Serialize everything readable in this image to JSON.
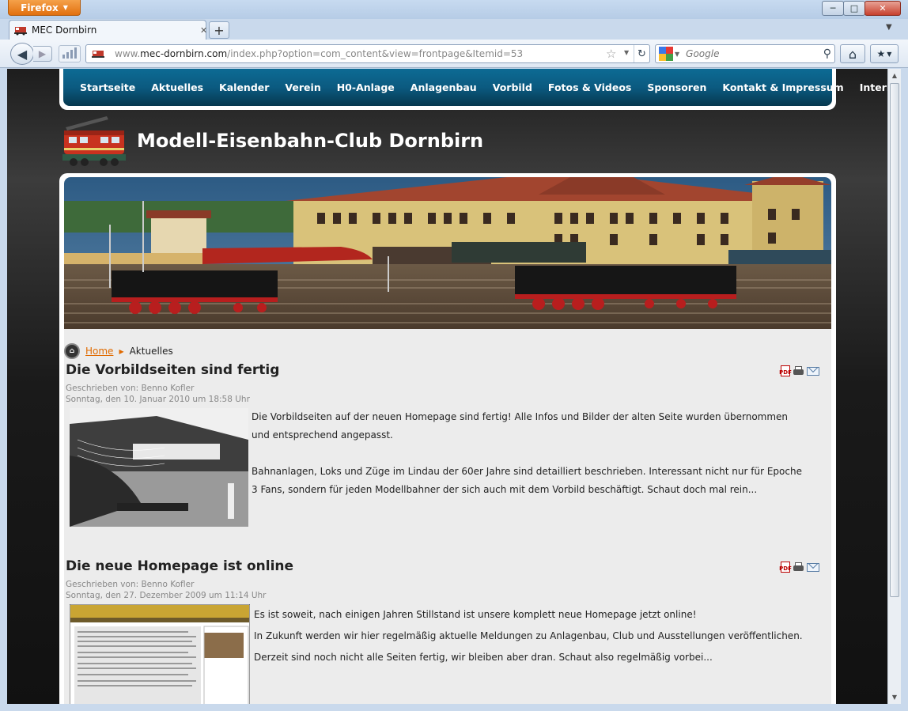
{
  "browser": {
    "menu_label": "Firefox",
    "tab_title": "MEC Dornbirn",
    "url_prefix": "www.",
    "url_domain": "mec-dornbirn.com",
    "url_path": "/index.php?option=com_content&view=frontpage&Itemid=53",
    "search_placeholder": "Google",
    "window_controls": {
      "minimize": "─",
      "maximize": "□",
      "close": "✕"
    }
  },
  "nav": {
    "items": [
      "Startseite",
      "Aktuelles",
      "Kalender",
      "Verein",
      "H0-Anlage",
      "Anlagenbau",
      "Vorbild",
      "Fotos & Videos",
      "Sponsoren",
      "Kontakt & Impressum",
      "Intern"
    ]
  },
  "header": {
    "site_title": "Modell-Eisenbahn-Club Dornbirn"
  },
  "breadcrumb": {
    "home": "Home",
    "current": "Aktuelles"
  },
  "articles": [
    {
      "title": "Die Vorbildseiten sind fertig",
      "author": "Geschrieben von: Benno Kofler",
      "date": "Sonntag, den 10. Januar 2010 um 18:58 Uhr",
      "paragraphs": [
        "Die Vorbildseiten auf der neuen Homepage sind fertig! Alle Infos und Bilder der alten Seite wurden übernommen und entsprechend angepasst.",
        "Bahnanlagen, Loks und Züge im Lindau der 60er Jahre sind detailliert beschrieben. Interessant nicht nur für Epoche 3 Fans, sondern für jeden Modellbahner der sich auch mit dem Vorbild beschäftigt. Schaut doch mal rein..."
      ]
    },
    {
      "title": "Die neue Homepage ist online",
      "author": "Geschrieben von: Benno Kofler",
      "date": "Sonntag, den 27. Dezember 2009 um 11:14 Uhr",
      "paragraphs": [
        "Es ist soweit, nach einigen Jahren Stillstand ist unsere komplett neue Homepage jetzt online!",
        "In Zukunft werden wir hier regelmäßig aktuelle Meldungen zu Anlagenbau, Club und Ausstellungen veröffentlichen. Derzeit sind noch nicht alle Seiten fertig, wir bleiben aber dran. Schaut also regelmäßig vorbei..."
      ]
    }
  ],
  "icons": {
    "pdf": "pdf-icon",
    "print": "print-icon",
    "email": "email-icon",
    "home": "home-icon",
    "bookmarks": "bookmarks-icon",
    "reload": "reload-icon",
    "star": "bookmark-star-icon"
  },
  "colors": {
    "nav_blue": "#0b5a80",
    "breadcrumb_link": "#e06a00",
    "firefox_orange": "#e2700f"
  }
}
